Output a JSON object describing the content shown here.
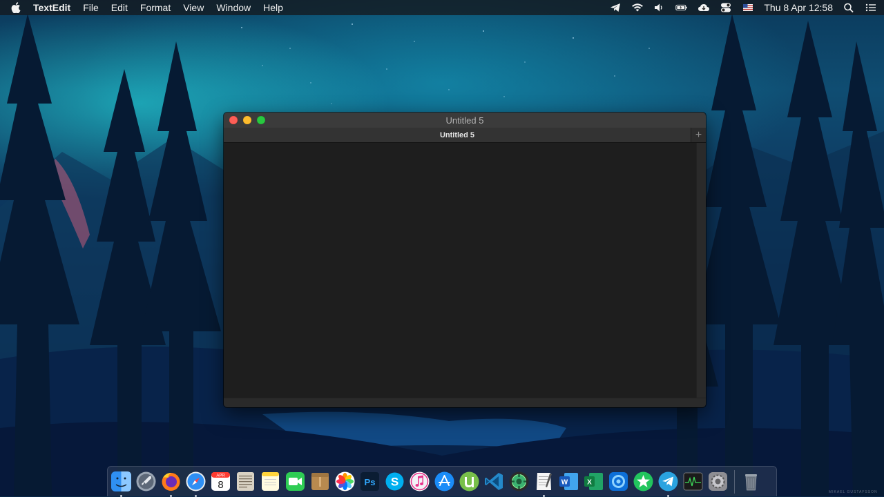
{
  "menubar": {
    "app_name": "TextEdit",
    "menus": [
      "File",
      "Edit",
      "Format",
      "View",
      "Window",
      "Help"
    ],
    "clock": "Thu 8 Apr  12:58",
    "status_icons": [
      "telegram-icon",
      "wifi-icon",
      "volume-icon",
      "battery-icon",
      "cloud-icon",
      "toggle-icon",
      "flag-icon",
      "search-icon",
      "list-icon"
    ]
  },
  "window": {
    "title": "Untitled 5",
    "tab_label": "Untitled 5",
    "tab_add": "+",
    "document_text": ""
  },
  "dock": {
    "items": [
      {
        "name": "finder",
        "running": true
      },
      {
        "name": "launchpad",
        "running": false
      },
      {
        "name": "firefox",
        "running": true
      },
      {
        "name": "safari",
        "running": true
      },
      {
        "name": "calendar",
        "running": false,
        "day": "8",
        "month": "APR"
      },
      {
        "name": "notes-list",
        "running": false
      },
      {
        "name": "notes",
        "running": false
      },
      {
        "name": "facetime",
        "running": false
      },
      {
        "name": "archive",
        "running": false
      },
      {
        "name": "photos",
        "running": false
      },
      {
        "name": "photoshop",
        "running": false,
        "label": "Ps"
      },
      {
        "name": "skype",
        "running": false,
        "label": "S"
      },
      {
        "name": "itunes",
        "running": false
      },
      {
        "name": "app-store",
        "running": false
      },
      {
        "name": "utorrent",
        "running": false
      },
      {
        "name": "vscode",
        "running": false
      },
      {
        "name": "gear-app",
        "running": false
      },
      {
        "name": "textedit",
        "running": true
      },
      {
        "name": "word",
        "running": false,
        "label": "W"
      },
      {
        "name": "excel",
        "running": false,
        "label": "X"
      },
      {
        "name": "edge-app",
        "running": false
      },
      {
        "name": "star-app",
        "running": false
      },
      {
        "name": "telegram",
        "running": true
      },
      {
        "name": "activity-monitor",
        "running": false
      },
      {
        "name": "system-preferences",
        "running": false
      }
    ]
  },
  "wallpaper_credit": "MIKAEL GUSTAFSSON",
  "colors": {
    "close": "#fc5f57",
    "minimize": "#fdbc2e",
    "maximize": "#28c840",
    "editor_bg": "#1e1e1e"
  }
}
